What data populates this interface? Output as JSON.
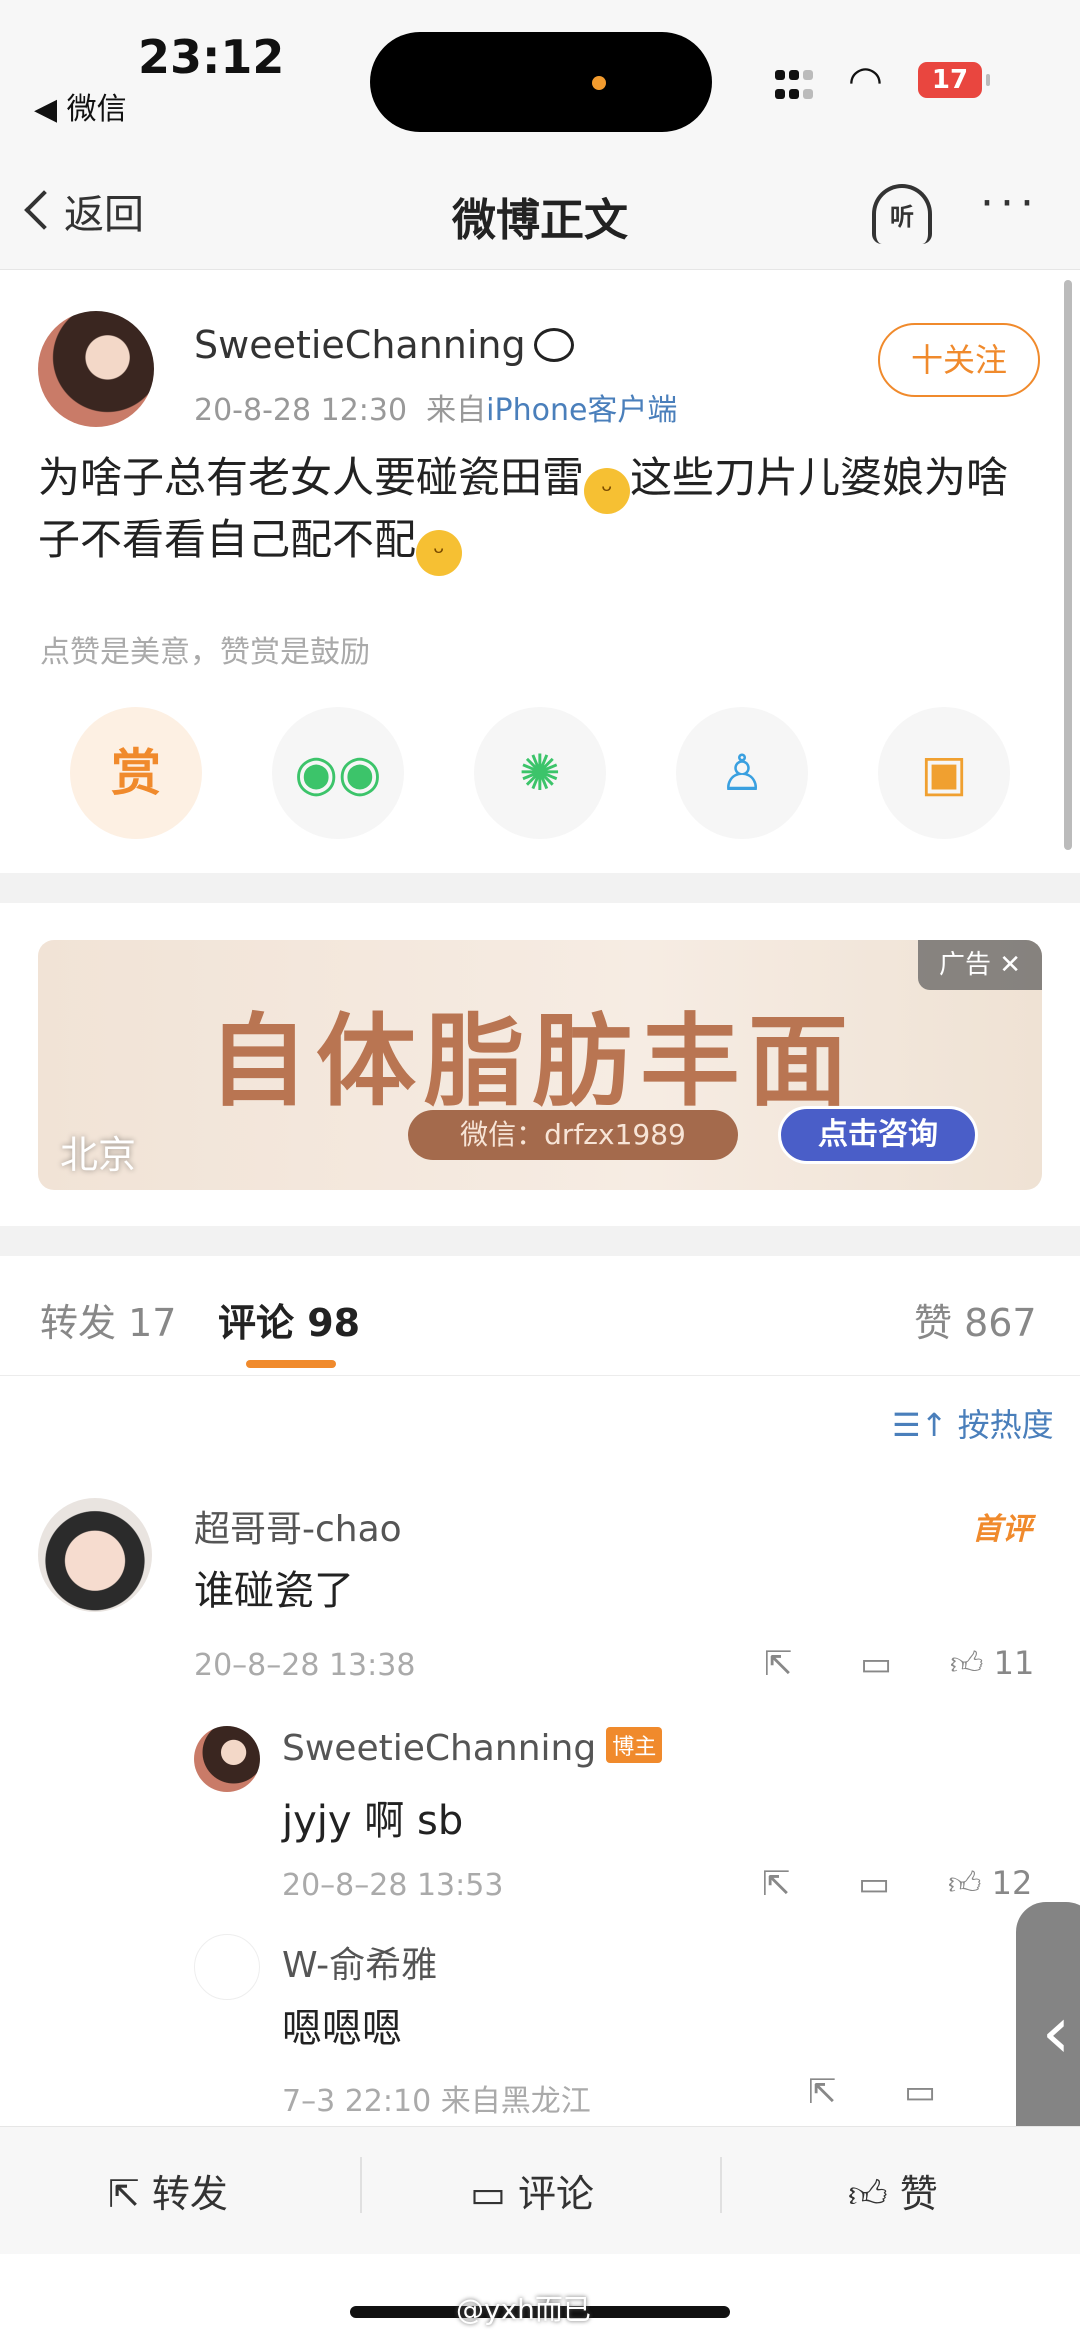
{
  "status_bar": {
    "time": "23:12",
    "back_app": "◀ 微信",
    "battery": "17"
  },
  "nav": {
    "back_label": "返回",
    "title": "微博正文",
    "listen_label": "听",
    "more": "···"
  },
  "post": {
    "username": "SweetieChanning",
    "date": "20-8-28 12:30",
    "source_prefix": "来自",
    "source": "iPhone客户端",
    "follow_label": "十关注",
    "text_part1": "为啥子总有老女人要碰瓷田雷",
    "text_part2": "这些刀片儿婆娘为啥子不看看自己配不配",
    "reward_tip": "点赞是美意，赞赏是鼓励",
    "share": {
      "reward_label": "赏"
    }
  },
  "ad": {
    "headline": "自体脂肪丰面",
    "wechat": "微信：drfzx1989",
    "cta": "点击咨询",
    "tag": "广告 ✕",
    "location": "北京"
  },
  "tabs": {
    "repost": "转发 17",
    "comment": "评论 98",
    "like": "赞 867"
  },
  "sort_label": "按热度",
  "comments": [
    {
      "name": "超哥哥-chao",
      "text": "谁碰瓷了",
      "time": "20–8–28 13:38",
      "likes": "11",
      "flag": "首评"
    },
    {
      "name": "SweetieChanning",
      "badge": "博主",
      "text": "jyjy 啊 sb",
      "time": "20–8–28 13:53",
      "likes": "12"
    },
    {
      "name": "W-俞希雅",
      "text": "嗯嗯嗯",
      "time": "7–3 22:10 来自黑龙江"
    }
  ],
  "bottom_bar": {
    "repost": "转发",
    "comment": "评论",
    "like": "赞"
  },
  "watermark": "@yxh而已"
}
